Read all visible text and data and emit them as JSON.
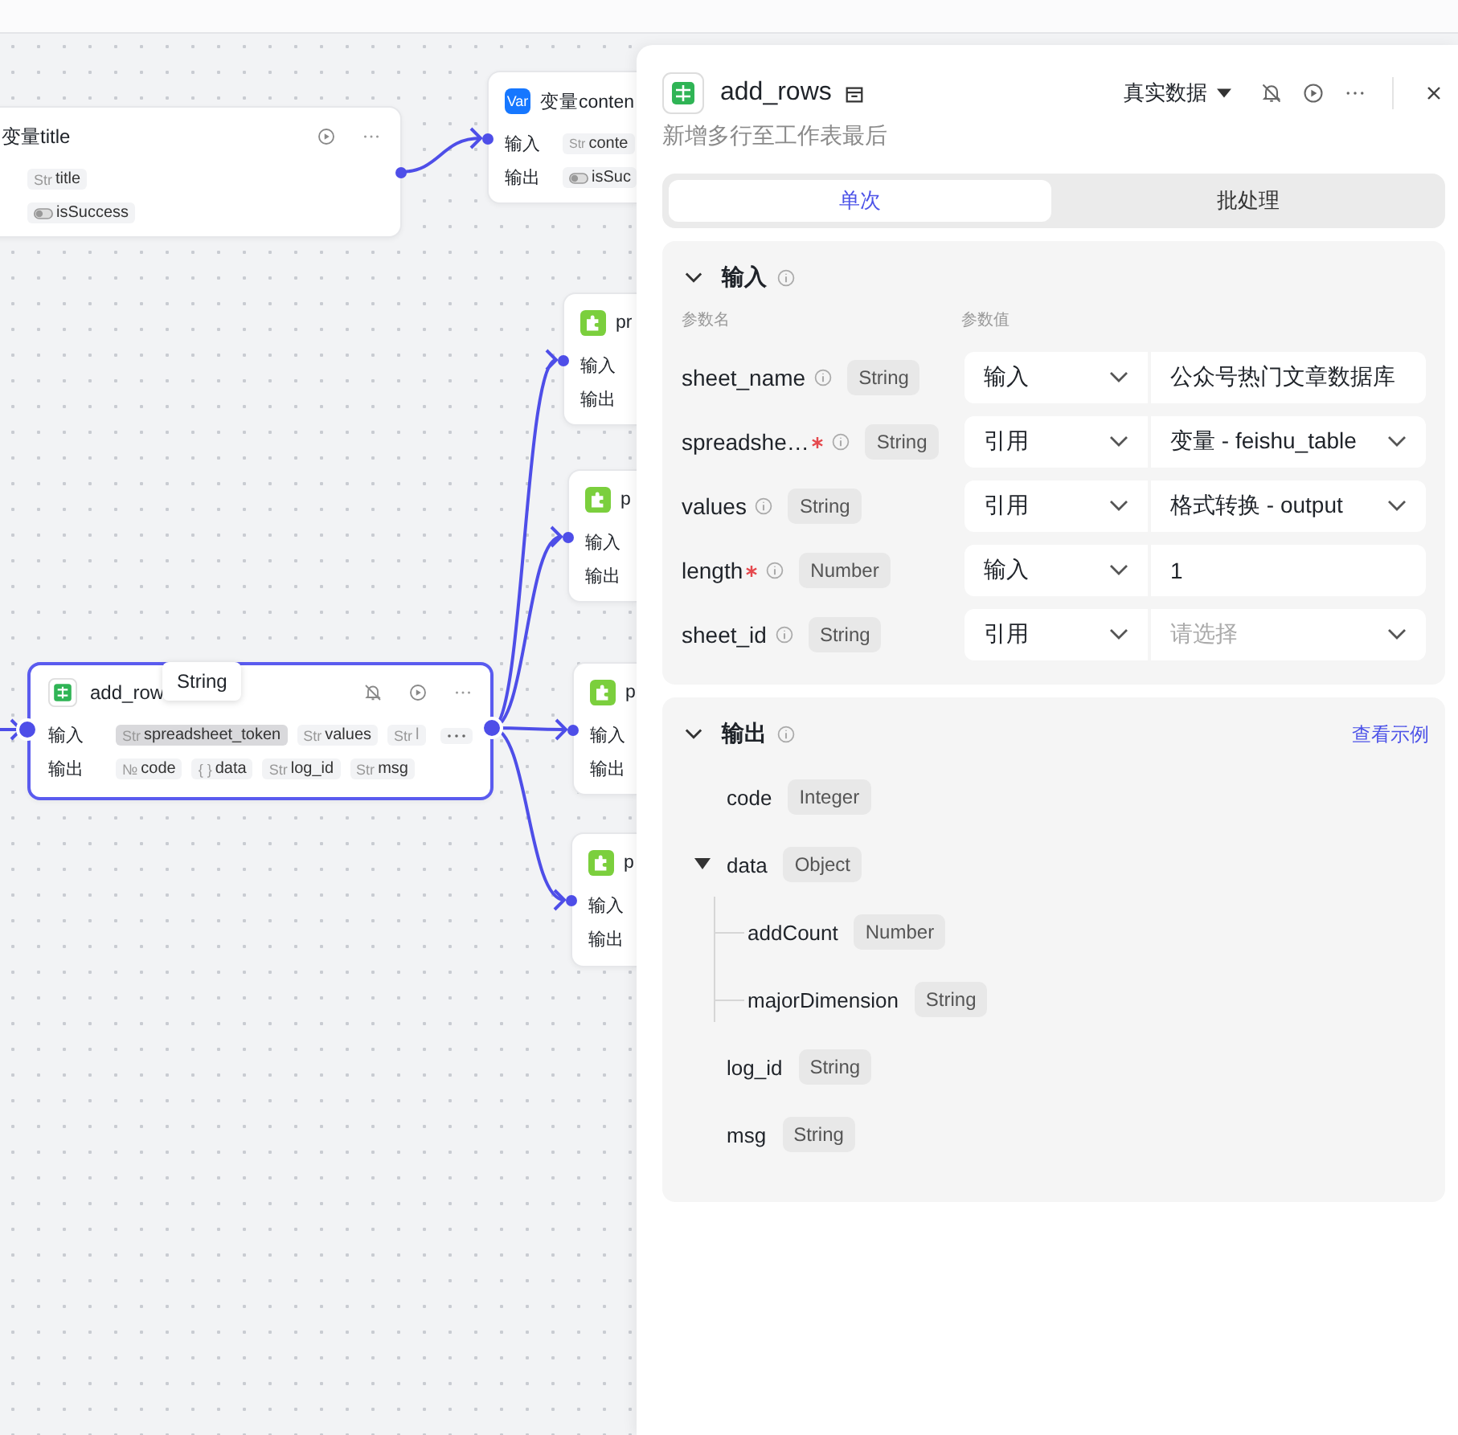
{
  "canvas": {
    "nodes": [
      {
        "kind": "plain",
        "title": "变量title",
        "selected": false,
        "actions": true,
        "clipped": false,
        "rows": [
          {
            "pills": [
              {
                "tag": "Str",
                "name": "title"
              }
            ]
          },
          {
            "pills": [
              {
                "kind": "toggle",
                "name": "isSuccess"
              }
            ]
          }
        ]
      },
      {
        "kind": "var",
        "badge": "Var",
        "title": "变量conten",
        "selected": false,
        "actions": false,
        "clipped": true,
        "rows": [
          {
            "label": "输入",
            "pills": [
              {
                "tag": "Str",
                "name": "conte"
              }
            ]
          },
          {
            "label": "输出",
            "pills": [
              {
                "kind": "toggle",
                "name": "isSuc"
              }
            ]
          }
        ]
      },
      {
        "kind": "plugin",
        "title": "pr",
        "selected": false,
        "actions": false,
        "clipped": true,
        "rows": [
          {
            "label": "输入",
            "pills": []
          },
          {
            "label": "输出",
            "pills": []
          }
        ]
      },
      {
        "kind": "plugin",
        "title": "p",
        "selected": false,
        "actions": false,
        "clipped": true,
        "rows": [
          {
            "label": "输入",
            "pills": []
          },
          {
            "label": "输出",
            "pills": []
          }
        ]
      },
      {
        "kind": "sheet",
        "title": "add_row",
        "selected": true,
        "actions": true,
        "clipped": false,
        "tooltip": "String",
        "rows": [
          {
            "label": "输入",
            "more": true,
            "pills": [
              {
                "tag": "Str",
                "name": "spreadsheet_token",
                "highlighted": true
              },
              {
                "tag": "Str",
                "name": "values"
              },
              {
                "tag": "Str",
                "name": "l",
                "faded": true
              }
            ]
          },
          {
            "label": "输出",
            "pills": [
              {
                "tag": "№",
                "name": "code"
              },
              {
                "tag": "{ }",
                "name": "data"
              },
              {
                "tag": "Str",
                "name": "log_id"
              },
              {
                "tag": "Str",
                "name": "msg"
              }
            ]
          }
        ]
      },
      {
        "kind": "plugin",
        "title": "p",
        "selected": false,
        "actions": false,
        "clipped": true,
        "rows": [
          {
            "label": "输入",
            "pills": []
          },
          {
            "label": "输出",
            "pills": []
          }
        ]
      },
      {
        "kind": "plugin",
        "title": "p",
        "selected": false,
        "actions": false,
        "clipped": true,
        "rows": [
          {
            "label": "输入",
            "pills": []
          },
          {
            "label": "输出",
            "pills": []
          }
        ]
      }
    ]
  },
  "panel": {
    "title": "add_rows",
    "mode": "真实数据",
    "description": "新增多行至工作表最后",
    "tabs": [
      {
        "label": "单次",
        "selected": true
      },
      {
        "label": "批处理",
        "selected": false
      }
    ],
    "inputs": {
      "title": "输入",
      "expanded": true,
      "name_header": "参数名",
      "value_header": "参数值",
      "params": [
        {
          "name": "sheet_name",
          "required": false,
          "type": "String",
          "source": "输入",
          "kind": "text",
          "value": "公众号热门文章数据库"
        },
        {
          "name": "spreadshe…",
          "required": true,
          "type": "String",
          "source": "引用",
          "kind": "select",
          "value": "变量 - feishu_table"
        },
        {
          "name": "values",
          "required": false,
          "type": "String",
          "source": "引用",
          "kind": "select",
          "value": "格式转换 - output"
        },
        {
          "name": "length",
          "required": true,
          "type": "Number",
          "source": "输入",
          "kind": "text",
          "value": "1"
        },
        {
          "name": "sheet_id",
          "required": false,
          "type": "String",
          "source": "引用",
          "kind": "select",
          "placeholder": "请选择"
        }
      ]
    },
    "outputs": {
      "title": "输出",
      "expanded": true,
      "link": "查看示例",
      "fields": [
        {
          "name": "code",
          "type": "Integer"
        },
        {
          "name": "data",
          "type": "Object",
          "expanded": true,
          "children": [
            {
              "name": "addCount",
              "type": "Number"
            },
            {
              "name": "majorDimension",
              "type": "String"
            }
          ]
        },
        {
          "name": "log_id",
          "type": "String"
        },
        {
          "name": "msg",
          "type": "String"
        }
      ]
    }
  }
}
